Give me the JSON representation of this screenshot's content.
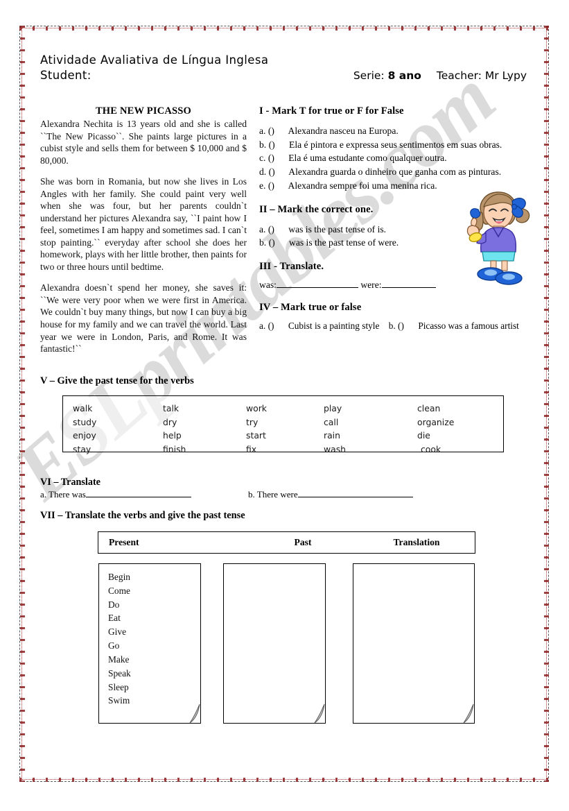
{
  "header": {
    "title": "Atividade Avaliativa de Língua Inglesa",
    "student_label": "Student:",
    "grade_label": "Serie:",
    "grade_value": "8 ano",
    "teacher_label": "Teacher:",
    "teacher_value": "Mr Lypy"
  },
  "watermark": {
    "text": "ESLprintables.com"
  },
  "reading": {
    "title": "THE NEW PICASSO",
    "paragraphs": [
      "Alexandra Nechita is 13 years old and she is called ``The New Picasso``. She paints large pictures in a cubist style and sells them for between $ 10,000 and $ 80,000.",
      "She was born in Romania, but  now she lives in Los Angles with her family. She could paint very well when she was  four, but her parents couldn`t understand her pictures Alexandra say, ``I paint  how I feel, sometimes I am happy and sometimes sad.  I can`t stop painting.``  everyday after school she does her homework,  plays with her little brother, then paints for two or three hours until bedtime.",
      "Alexandra doesn`t spend her money, she saves it: ``We were very poor when we were first in America. We couldn`t buy many things, but now I can buy a big house for my family and we can travel the world. Last year we were in London, Paris, and Rome. It was fantastic!``"
    ]
  },
  "exercise_1": {
    "heading": "I - Mark T for true or F for False",
    "items": [
      {
        "letter": "a.",
        "text": "Alexandra nasceu na Europa."
      },
      {
        "letter": "b.",
        "text": "Ela é pintora e expressa seus sentimentos em suas obras."
      },
      {
        "letter": "c.",
        "text": "Ela é uma estudante como qualquer outra."
      },
      {
        "letter": "d.",
        "text": "Alexandra guarda o dinheiro que ganha com as pinturas."
      },
      {
        "letter": "e.",
        "text": "Alexandra sempre foi uma menina rica."
      }
    ]
  },
  "exercise_2": {
    "heading": "II – Mark the correct one.",
    "items": [
      {
        "letter": "a.",
        "text": "was is the past tense of is."
      },
      {
        "letter": "b.",
        "text": "was is the past tense of were."
      }
    ]
  },
  "exercise_3": {
    "heading": "III -  Translate.",
    "field_1_label": "was:",
    "field_2_label": "were:"
  },
  "exercise_4": {
    "heading": "IV – Mark true or false",
    "items": [
      {
        "letter": "a.",
        "text": "Cubist is a painting style"
      },
      {
        "letter": "b.",
        "text": "Picasso was a famous artist"
      }
    ]
  },
  "exercise_5": {
    "heading": "V – Give the past tense for the verbs",
    "columns": [
      [
        "walk",
        "study",
        "enjoy",
        "stay"
      ],
      [
        "talk",
        "dry",
        "help",
        "finish"
      ],
      [
        "work",
        "try",
        "start",
        "fix"
      ],
      [
        "play",
        "call",
        "rain",
        "wash"
      ],
      [
        "clean",
        "organize",
        "die",
        "cook"
      ]
    ]
  },
  "exercise_6": {
    "heading": "VI – Translate",
    "item_a_letter": "a.",
    "item_a_text": "There was",
    "item_b_letter": "b.",
    "item_b_text": "There were"
  },
  "exercise_7": {
    "heading": "VII – Translate the verbs and give the past tense",
    "table_headers": [
      "Present",
      "Past",
      "Translation"
    ],
    "present_verbs": [
      "Begin",
      "Come",
      "Do",
      "Eat",
      "Give",
      "Go",
      "Make",
      "Speak",
      "Sleep",
      "Swim"
    ],
    "past_verbs": [],
    "translation_verbs": []
  },
  "illustration": {
    "name": "cartoon-girl-thumbs-up"
  },
  "colors": {
    "border_red": "#8a2020",
    "text": "#000000",
    "watermark": "rgba(30,30,30,0.16)",
    "girl_shirt": "#7b6ede",
    "girl_skirt": "#6fe3ee",
    "girl_shoes": "#1f63d6",
    "girl_bow": "#1f63d6",
    "girl_hair": "#b9946b",
    "girl_skin": "#fbd3b4"
  }
}
